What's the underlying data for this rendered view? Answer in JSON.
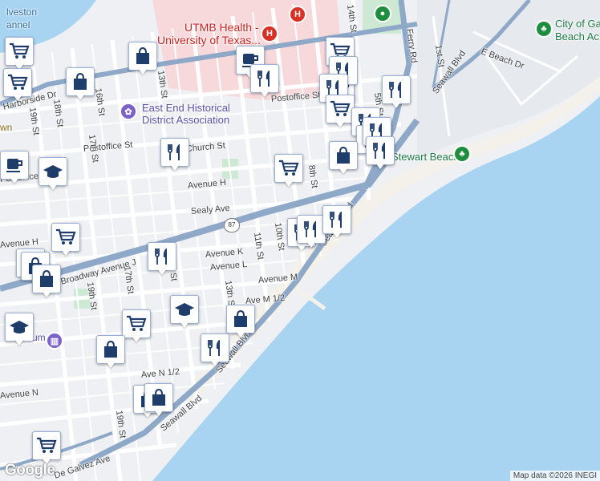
{
  "map": {
    "colors": {
      "water": "#a8d4f2",
      "land": "#eef0f3",
      "road": "#ffffff",
      "highway": "#8ea8c8",
      "medical": "#f7d9dc",
      "park": "#cde8d3",
      "pin_icon": "#1f3d6b"
    },
    "labels": {
      "water_north": "lveston",
      "water_north2": "annel",
      "utmb_1": "UTMB Health -",
      "utmb_2": "University of Texas...",
      "east_end_1": "East End Historical",
      "east_end_2": "District Association",
      "stewart_beach": "Stewart Beach",
      "city_beach_1": "City of Ga",
      "city_beach_2": "Beach Ac",
      "st_14th": "14th St",
      "ferry_rd": "Ferry Rd",
      "seawall_blvd_ne": "Seawall Blvd",
      "e_beach_dr": "E Beach Dr",
      "st_1st": "1st St",
      "harborside_dr": "Harborside Dr",
      "st_19th_a": "19th St",
      "st_18th": "18th St",
      "st_16th": "16th St",
      "st_13th_a": "13th St",
      "postoffice_st_e": "Postoffice St",
      "postoffice_st_w": "Postoffice St",
      "postoffice_st_far": "Postoffice",
      "st_17th_a": "17th St",
      "church_st": "Church St",
      "st_5th": "5th St",
      "st_8th": "8th St",
      "avenue_h": "Avenue H",
      "sealy_ave": "Sealy Ave",
      "seawall_blvd_mid": "Seawall Blvd",
      "st_10th": "10th St",
      "st_11th": "11th St",
      "route_87": "87",
      "avenue_k": "Avenue K",
      "avenue_l": "Avenue L",
      "avenue_m": "Avenue M",
      "ave_m_half": "Ave M 1/2",
      "broadway": "Broadway Avenue J",
      "st_17th_b": "17th St",
      "st_19th_b": "19th St",
      "st_15th": "15th St",
      "st_13th_b": "13th St",
      "seawall_blvd_sw": "Seawall Blvd",
      "ave_n_half": "Ave N 1/2",
      "avenue_n": "Avenue N",
      "st_19th_c": "19th St",
      "de_galvez": "De Galvez Ave",
      "museum": "um",
      "town": "wn",
      "avenue_h_w": "Avenue H"
    },
    "markers": [
      {
        "type": "grocery",
        "icon": "cart-icon"
      },
      {
        "type": "shopping",
        "icon": "bag-icon"
      },
      {
        "type": "grocery",
        "icon": "cart-icon"
      },
      {
        "type": "shopping",
        "icon": "bag-icon"
      },
      {
        "type": "grocery",
        "icon": "cart-icon"
      },
      {
        "type": "cafe",
        "icon": "cup-icon"
      },
      {
        "type": "restaurant",
        "icon": "fork-knife-icon"
      },
      {
        "type": "grocery",
        "icon": "cart-icon"
      },
      {
        "type": "restaurant",
        "icon": "fork-knife-icon"
      },
      {
        "type": "restaurant",
        "icon": "fork-knife-icon"
      },
      {
        "type": "restaurant",
        "icon": "fork-knife-icon"
      },
      {
        "type": "grocery",
        "icon": "cart-icon"
      },
      {
        "type": "restaurant",
        "icon": "fork-knife-icon"
      },
      {
        "type": "restaurant",
        "icon": "fork-knife-icon"
      },
      {
        "type": "restaurant",
        "icon": "fork-knife-icon"
      },
      {
        "type": "shopping",
        "icon": "bag-icon"
      },
      {
        "type": "restaurant",
        "icon": "fork-knife-icon"
      },
      {
        "type": "school",
        "icon": "school-icon"
      },
      {
        "type": "restaurant",
        "icon": "fork-knife-icon"
      },
      {
        "type": "grocery",
        "icon": "cart-icon"
      },
      {
        "type": "restaurant",
        "icon": "fork-knife-icon"
      },
      {
        "type": "restaurant",
        "icon": "fork-knife-icon"
      },
      {
        "type": "restaurant",
        "icon": "fork-knife-icon"
      },
      {
        "type": "grocery",
        "icon": "cart-icon"
      },
      {
        "type": "shopping",
        "icon": "bag-icon"
      },
      {
        "type": "shopping",
        "icon": "bag-icon"
      },
      {
        "type": "shopping",
        "icon": "bag-icon"
      },
      {
        "type": "restaurant",
        "icon": "fork-knife-icon"
      },
      {
        "type": "school",
        "icon": "school-icon"
      },
      {
        "type": "grocery",
        "icon": "cart-icon"
      },
      {
        "type": "school",
        "icon": "school-icon"
      },
      {
        "type": "shopping",
        "icon": "bag-icon"
      },
      {
        "type": "shopping",
        "icon": "bag-icon"
      },
      {
        "type": "restaurant",
        "icon": "fork-knife-icon"
      },
      {
        "type": "shopping",
        "icon": "bag-icon"
      },
      {
        "type": "shopping",
        "icon": "bag-icon"
      },
      {
        "type": "grocery",
        "icon": "cart-icon"
      },
      {
        "type": "cafe",
        "icon": "cup-icon"
      }
    ],
    "attribution": "Map data ©2026 INEGI",
    "logo": "Google"
  }
}
